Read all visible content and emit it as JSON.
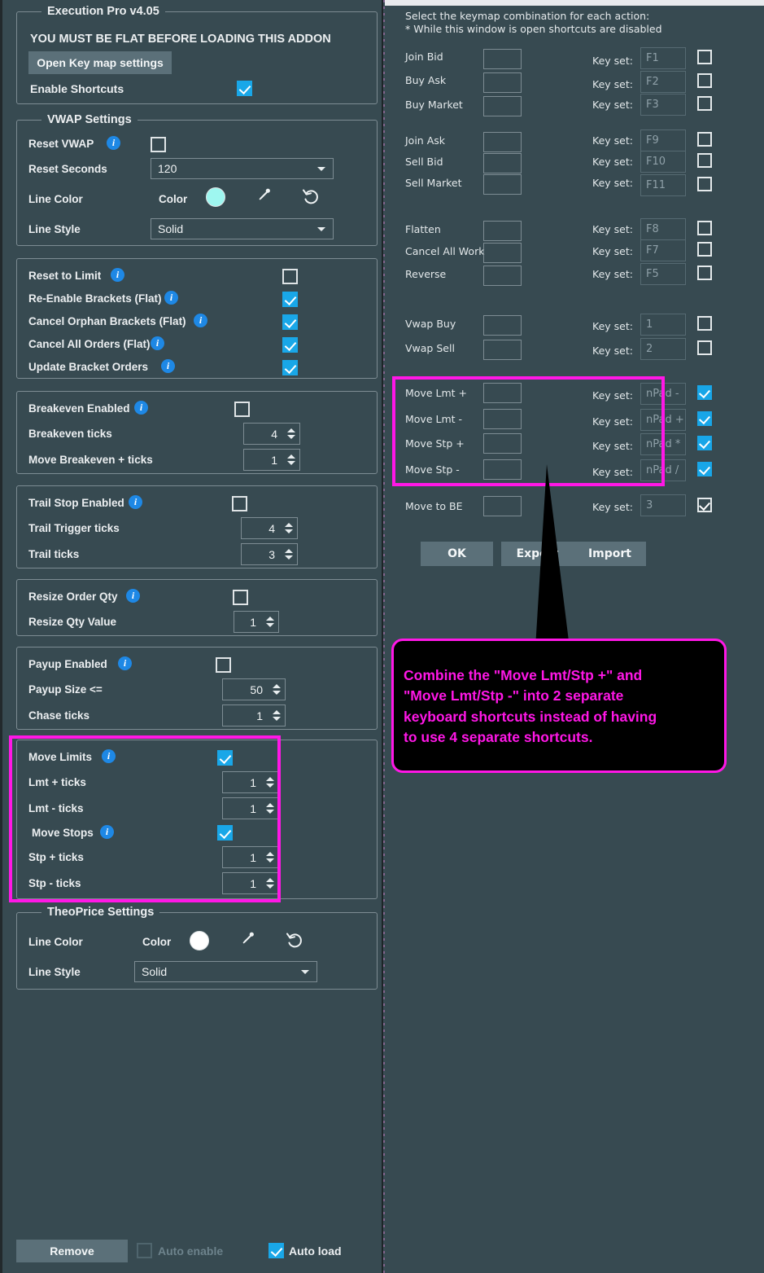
{
  "left": {
    "main_group": {
      "legend": "Execution Pro v4.05",
      "warning": "YOU MUST BE FLAT BEFORE LOADING THIS ADDON",
      "open_keymap_button": "Open Key map settings",
      "enable_shortcuts_label": "Enable Shortcuts",
      "enable_shortcuts_checked": true
    },
    "vwap_group": {
      "legend": "VWAP Settings",
      "reset_vwap_label": "Reset VWAP",
      "reset_vwap_checked": false,
      "reset_seconds_label": "Reset Seconds",
      "reset_seconds_value": "120",
      "line_color_label": "Line Color",
      "color_label": "Color",
      "color_hex": "#9EF7F0",
      "line_style_label": "Line Style",
      "line_style_value": "Solid"
    },
    "flat_group": {
      "rows": [
        {
          "label": "Reset to Limit",
          "checked": false
        },
        {
          "label": "Re-Enable Brackets (Flat)",
          "checked": true
        },
        {
          "label": "Cancel Orphan Brackets (Flat)",
          "checked": true
        },
        {
          "label": "Cancel All Orders (Flat)",
          "checked": true
        },
        {
          "label": "Update Bracket Orders",
          "checked": true
        }
      ]
    },
    "breakeven_group": {
      "enabled_label": "Breakeven Enabled",
      "enabled_checked": false,
      "ticks_label": "Breakeven ticks",
      "ticks_value": "4",
      "move_label": "Move Breakeven + ticks",
      "move_value": "1"
    },
    "trail_group": {
      "enabled_label": "Trail Stop Enabled",
      "enabled_checked": false,
      "trigger_label": "Trail Trigger ticks",
      "trigger_value": "4",
      "ticks_label": "Trail ticks",
      "ticks_value": "3"
    },
    "resize_group": {
      "enabled_label": "Resize Order Qty",
      "enabled_checked": false,
      "value_label": "Resize Qty Value",
      "value_value": "1"
    },
    "payup_group": {
      "enabled_label": "Payup Enabled",
      "enabled_checked": false,
      "size_label": "Payup Size <=",
      "size_value": "50",
      "chase_label": "Chase ticks",
      "chase_value": "1"
    },
    "move_group": {
      "limits_label": "Move Limits",
      "limits_checked": true,
      "lmt_plus_label": "Lmt + ticks",
      "lmt_plus_value": "1",
      "lmt_minus_label": "Lmt - ticks",
      "lmt_minus_value": "1",
      "stops_label": "Move Stops",
      "stops_checked": true,
      "stp_plus_label": "Stp + ticks",
      "stp_plus_value": "1",
      "stp_minus_label": "Stp - ticks",
      "stp_minus_value": "1"
    },
    "theoprice_group": {
      "legend": "TheoPrice Settings",
      "line_color_label": "Line Color",
      "color_label": "Color",
      "color_hex": "#FFFFFF",
      "line_style_label": "Line Style",
      "line_style_value": "Solid"
    },
    "footer": {
      "remove_button": "Remove",
      "auto_enable_label": "Auto enable",
      "auto_enable_checked": false,
      "auto_load_label": "Auto load",
      "auto_load_checked": true
    }
  },
  "right": {
    "header_line1": "Select the keymap combination for each action:",
    "header_line2": "* While this window is open shortcuts are disabled",
    "keyset_label": "Key set:",
    "groups": [
      {
        "rows": [
          {
            "action": "Join Bid",
            "combo": "",
            "key": "F1",
            "checked": false
          },
          {
            "action": "Buy Ask",
            "combo": "",
            "key": "F2",
            "checked": false
          },
          {
            "action": "Buy Market",
            "combo": "",
            "key": "F3",
            "checked": false
          }
        ]
      },
      {
        "rows": [
          {
            "action": "Join Ask",
            "combo": "",
            "key": "F9",
            "checked": false
          },
          {
            "action": "Sell Bid",
            "combo": "",
            "key": "F10",
            "checked": false
          },
          {
            "action": "Sell Market",
            "combo": "",
            "key": "F11",
            "checked": false
          }
        ]
      },
      {
        "rows": [
          {
            "action": "Flatten",
            "combo": "",
            "key": "F8",
            "checked": false
          },
          {
            "action": "Cancel All Work",
            "combo": "",
            "key": "F7",
            "checked": false
          },
          {
            "action": "Reverse",
            "combo": "",
            "key": "F5",
            "checked": false
          }
        ]
      },
      {
        "rows": [
          {
            "action": "Vwap Buy",
            "combo": "",
            "key": "1",
            "checked": false
          },
          {
            "action": "Vwap Sell",
            "combo": "",
            "key": "2",
            "checked": false
          }
        ]
      },
      {
        "rows": [
          {
            "action": "Move Lmt +",
            "combo": "",
            "key": "nPad -",
            "checked": true
          },
          {
            "action": "Move Lmt -",
            "combo": "",
            "key": "nPad +",
            "checked": true
          },
          {
            "action": "Move Stp +",
            "combo": "",
            "key": "nPad *",
            "checked": true
          },
          {
            "action": "Move Stp -",
            "combo": "",
            "key": "nPad /",
            "checked": true
          }
        ]
      },
      {
        "rows": [
          {
            "action": "Move to BE",
            "combo": "",
            "key": "3",
            "checked": false
          }
        ]
      }
    ],
    "buttons": {
      "ok": "OK",
      "export": "Export",
      "import": "Import"
    }
  },
  "annotation": {
    "text": "Combine the \"Move Lmt/Stp +\" and\n\"Move Lmt/Stp -\" into 2 separate\nkeyboard shortcuts instead of having\nto use 4 separate shortcuts.",
    "highlight_color": "#FF17E6"
  }
}
